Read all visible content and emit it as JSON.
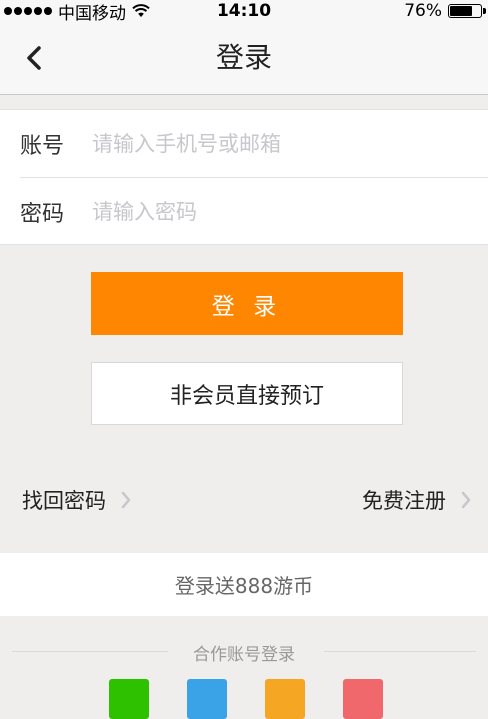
{
  "status_bar": {
    "carrier": "中国移动",
    "time": "14:10",
    "battery_text": "76%",
    "battery_level": 0.76
  },
  "nav": {
    "title": "登录",
    "back_icon": "chevron-left-icon"
  },
  "form": {
    "account_label": "账号",
    "account_placeholder": "请输入手机号或邮箱",
    "account_value": "",
    "password_label": "密码",
    "password_placeholder": "请输入密码",
    "password_value": ""
  },
  "buttons": {
    "login": "登 录",
    "guest_booking": "非会员直接预订"
  },
  "links": {
    "forgot_password": "找回密码",
    "register": "免费注册"
  },
  "promo": {
    "text": "登录送888游币"
  },
  "partner": {
    "title": "合作账号登录",
    "icons": [
      {
        "name": "wechat-icon",
        "color": "#2dc100"
      },
      {
        "name": "qq-icon",
        "color": "#3aa3e8"
      },
      {
        "name": "weibo-icon",
        "color": "#f5a623"
      },
      {
        "name": "alipay-icon",
        "color": "#f0686b"
      }
    ]
  },
  "colors": {
    "accent": "#fe8600",
    "background": "#efeeec"
  }
}
